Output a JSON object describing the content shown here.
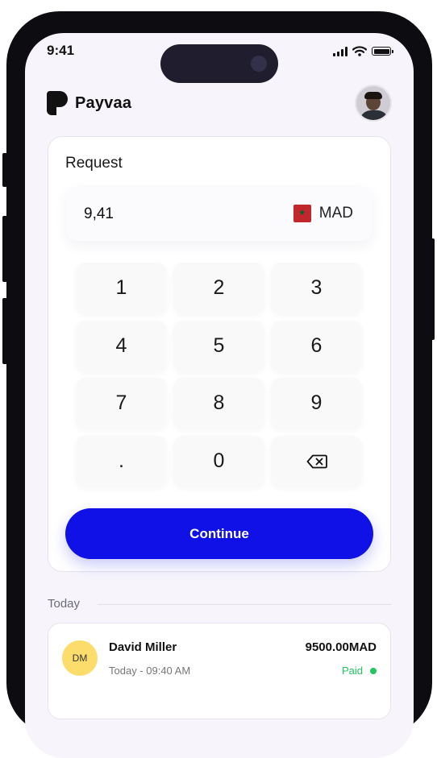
{
  "status_bar": {
    "time": "9:41"
  },
  "brand": {
    "name": "Payvaa"
  },
  "request": {
    "title": "Request",
    "amount": "9,41",
    "currency": "MAD"
  },
  "keypad": {
    "keys": [
      "1",
      "2",
      "3",
      "4",
      "5",
      "6",
      "7",
      "8",
      "9",
      ".",
      "0"
    ],
    "backspace_icon": "backspace-icon"
  },
  "continue_label": "Continue",
  "section_label": "Today",
  "transaction": {
    "initials": "DM",
    "name": "David Miller",
    "time": "Today - 09:40 AM",
    "amount": "9500.00MAD",
    "status": "Paid"
  },
  "colors": {
    "accent": "#1011e7",
    "paid": "#22c55e",
    "avatar_yellow": "#fcdd6b",
    "flag_red": "#c1272d"
  }
}
